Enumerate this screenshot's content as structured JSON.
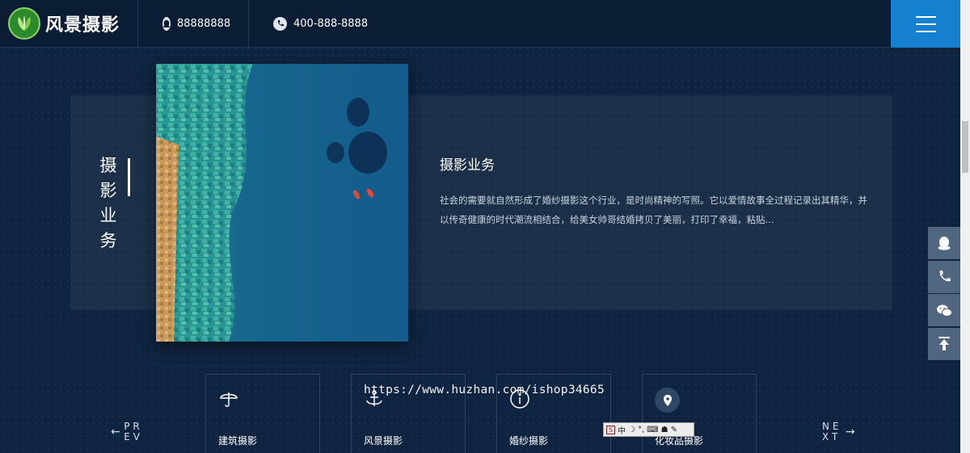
{
  "header": {
    "brand": "风景摄影",
    "qq": "88888888",
    "phone": "400-888-8888",
    "menu_icon": "hamburger-menu-icon",
    "accent_color": "#1680d0"
  },
  "feature": {
    "vertical_title": "摄影业务",
    "title": "摄影业务",
    "description": "社会的需要就自然形成了婚纱摄影这个行业，是时尚精神的写照。它以爱情故事全过程记录出其精华，并以传奇健康的时代潮流相结合，给美女帅哥结婚拷贝了美丽，打印了幸福，粘贴..."
  },
  "services": [
    {
      "label": "建筑摄影",
      "icon": "umbrella-icon"
    },
    {
      "label": "风景摄影",
      "icon": "anchor-icon"
    },
    {
      "label": "婚纱摄影",
      "icon": "info-circle-icon"
    },
    {
      "label": "化妆品摄影",
      "icon": "location-pin-icon"
    }
  ],
  "pager": {
    "prev_top": "PR",
    "prev_bottom": "EV",
    "next_top": "NE",
    "next_bottom": "XT"
  },
  "side_bar": [
    "qq-icon",
    "phone-icon",
    "wechat-icon",
    "back-to-top-icon"
  ],
  "watermark": "https://www.huzhan.com/ishop34665",
  "ime_toolbar": {
    "mode": "中"
  }
}
